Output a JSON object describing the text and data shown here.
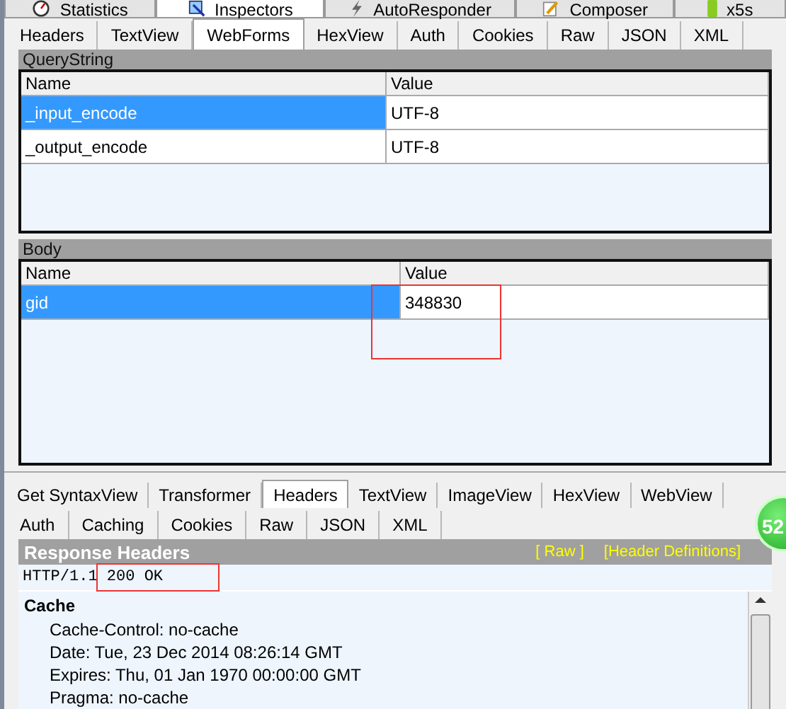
{
  "top_tabs": [
    {
      "label": "Statistics",
      "selected": false
    },
    {
      "label": "Inspectors",
      "selected": true
    },
    {
      "label": "AutoResponder",
      "selected": false
    },
    {
      "label": "Composer",
      "selected": false
    },
    {
      "label": "x5s",
      "selected": false
    }
  ],
  "request_tabs": [
    {
      "label": "Headers",
      "selected": false
    },
    {
      "label": "TextView",
      "selected": false
    },
    {
      "label": "WebForms",
      "selected": true
    },
    {
      "label": "HexView",
      "selected": false
    },
    {
      "label": "Auth",
      "selected": false
    },
    {
      "label": "Cookies",
      "selected": false
    },
    {
      "label": "Raw",
      "selected": false
    },
    {
      "label": "JSON",
      "selected": false
    },
    {
      "label": "XML",
      "selected": false
    }
  ],
  "query_string": {
    "title": "QueryString",
    "columns": [
      "Name",
      "Value"
    ],
    "rows": [
      {
        "name": "_input_encode",
        "value": "UTF-8",
        "selected": true
      },
      {
        "name": "_output_encode",
        "value": "UTF-8",
        "selected": false
      }
    ]
  },
  "body": {
    "title": "Body",
    "columns": [
      "Name",
      "Value"
    ],
    "rows": [
      {
        "name": "gid",
        "value": "348830",
        "selected": true
      }
    ]
  },
  "response_tabs": [
    [
      {
        "label": "Get SyntaxView",
        "selected": false
      },
      {
        "label": "Transformer",
        "selected": false
      },
      {
        "label": "Headers",
        "selected": true
      },
      {
        "label": "TextView",
        "selected": false
      },
      {
        "label": "ImageView",
        "selected": false
      },
      {
        "label": "HexView",
        "selected": false
      },
      {
        "label": "WebView",
        "selected": false
      }
    ],
    [
      {
        "label": "Auth",
        "selected": false
      },
      {
        "label": "Caching",
        "selected": false
      },
      {
        "label": "Cookies",
        "selected": false
      },
      {
        "label": "Raw",
        "selected": false
      },
      {
        "label": "JSON",
        "selected": false
      },
      {
        "label": "XML",
        "selected": false
      }
    ]
  ],
  "badge": "52",
  "response_headers": {
    "title": "Response Headers",
    "links": [
      "[ Raw ]",
      "[Header Definitions]"
    ],
    "status_line": "HTTP/1.1 200 OK",
    "groups": [
      {
        "name": "Cache",
        "headers": [
          "Cache-Control: no-cache",
          "Date: Tue, 23 Dec 2014 08:26:14 GMT",
          "Expires: Thu, 01 Jan 1970 00:00:00 GMT",
          "Pragma: no-cache"
        ]
      }
    ]
  }
}
